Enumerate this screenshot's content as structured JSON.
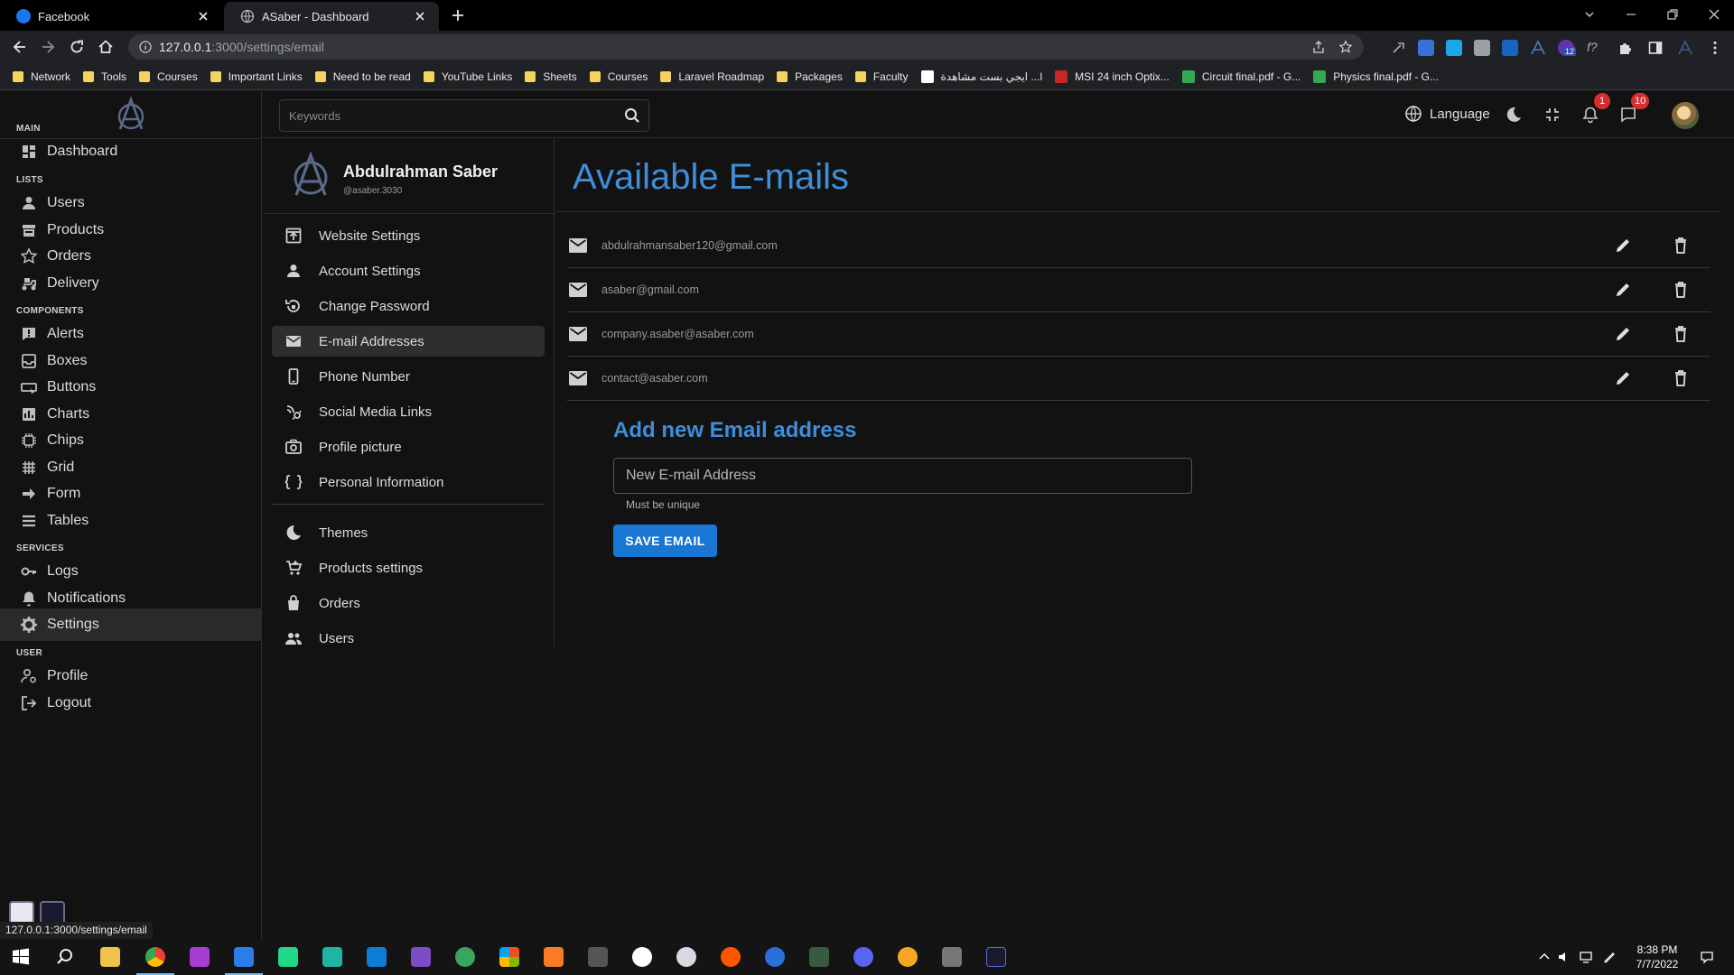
{
  "browser": {
    "tabs": [
      {
        "title": "Facebook"
      },
      {
        "title": "ASaber - Dashboard"
      }
    ],
    "url": {
      "host": "127.0.0.1",
      "path": ":3000/settings/email"
    },
    "status_url": "127.0.0.1:3000/settings/email",
    "bookmarks": [
      {
        "label": "Network",
        "kind": "folder"
      },
      {
        "label": "Tools",
        "kind": "folder"
      },
      {
        "label": "Courses",
        "kind": "folder"
      },
      {
        "label": "Important Links",
        "kind": "folder"
      },
      {
        "label": "Need to be read",
        "kind": "folder"
      },
      {
        "label": "YouTube Links",
        "kind": "folder"
      },
      {
        "label": "Sheets",
        "kind": "folder"
      },
      {
        "label": "Courses",
        "kind": "folder"
      },
      {
        "label": "Laravel Roadmap",
        "kind": "folder"
      },
      {
        "label": "Packages",
        "kind": "folder"
      },
      {
        "label": "Faculty",
        "kind": "folder"
      },
      {
        "label": "ايجي بست مشاهدة ...l",
        "kind": "site",
        "color": "#ffffff"
      },
      {
        "label": "MSI 24 inch Optix...",
        "kind": "site",
        "color": "#c62828"
      },
      {
        "label": "Circuit final.pdf - G...",
        "kind": "site",
        "color": "#34a853"
      },
      {
        "label": "Physics final.pdf - G...",
        "kind": "site",
        "color": "#34a853"
      }
    ],
    "extension_badge": "12"
  },
  "sidebar": {
    "sections": [
      {
        "title": "MAIN",
        "items": [
          {
            "label": "Dashboard",
            "icon": "dashboard-icon"
          }
        ]
      },
      {
        "title": "LISTS",
        "items": [
          {
            "label": "Users",
            "icon": "user-icon"
          },
          {
            "label": "Products",
            "icon": "store-icon"
          },
          {
            "label": "Orders",
            "icon": "star-icon"
          },
          {
            "label": "Delivery",
            "icon": "delivery-icon"
          }
        ]
      },
      {
        "title": "COMPONENTS",
        "items": [
          {
            "label": "Alerts",
            "icon": "alert-icon"
          },
          {
            "label": "Boxes",
            "icon": "boxes-icon"
          },
          {
            "label": "Buttons",
            "icon": "buttons-icon"
          },
          {
            "label": "Charts",
            "icon": "chart-icon"
          },
          {
            "label": "Chips",
            "icon": "chip-icon"
          },
          {
            "label": "Grid",
            "icon": "grid-icon"
          },
          {
            "label": "Form",
            "icon": "form-icon"
          },
          {
            "label": "Tables",
            "icon": "tables-icon"
          }
        ]
      },
      {
        "title": "SERVICES",
        "items": [
          {
            "label": "Logs",
            "icon": "key-icon"
          },
          {
            "label": "Notifications",
            "icon": "bell-icon"
          },
          {
            "label": "Settings",
            "icon": "gear-icon",
            "active": true
          }
        ]
      },
      {
        "title": "USER",
        "items": [
          {
            "label": "Profile",
            "icon": "profile-icon"
          },
          {
            "label": "Logout",
            "icon": "logout-icon"
          }
        ]
      }
    ]
  },
  "header": {
    "search_placeholder": "Keywords",
    "language_label": "Language",
    "notifications_count": "1",
    "messages_count": "10"
  },
  "settings_panel": {
    "name": "Abdulrahman Saber",
    "handle": "@asaber.3030",
    "items": [
      {
        "label": "Website Settings",
        "icon": "website-settings-icon"
      },
      {
        "label": "Account Settings",
        "icon": "account-icon"
      },
      {
        "label": "Change Password",
        "icon": "password-icon"
      },
      {
        "label": "E-mail Addresses",
        "icon": "mail-icon",
        "active": true
      },
      {
        "label": "Phone Number",
        "icon": "phone-icon"
      },
      {
        "label": "Social Media Links",
        "icon": "social-icon"
      },
      {
        "label": "Profile picture",
        "icon": "camera-icon"
      },
      {
        "label": "Personal Information",
        "icon": "personal-info-icon"
      },
      {
        "label": "Themes",
        "icon": "moon-icon"
      },
      {
        "label": "Products settings",
        "icon": "cart-icon"
      },
      {
        "label": "Orders",
        "icon": "bag-icon"
      },
      {
        "label": "Users",
        "icon": "users-icon"
      }
    ]
  },
  "main": {
    "title": "Available E-mails",
    "emails": [
      "abdulrahmansaber120@gmail.com",
      "asaber@gmail.com",
      "company.asaber@asaber.com",
      "contact@asaber.com"
    ],
    "add_title": "Add new Email address",
    "input_placeholder": "New E-mail Address",
    "helper_text": "Must be unique",
    "save_label": "SAVE EMAIL"
  },
  "taskbar": {
    "time": "8:38 PM",
    "date": "7/7/2022"
  },
  "colors": {
    "accent": "#3e8ed8",
    "button": "#1976d2",
    "badge": "#d32f2f"
  }
}
